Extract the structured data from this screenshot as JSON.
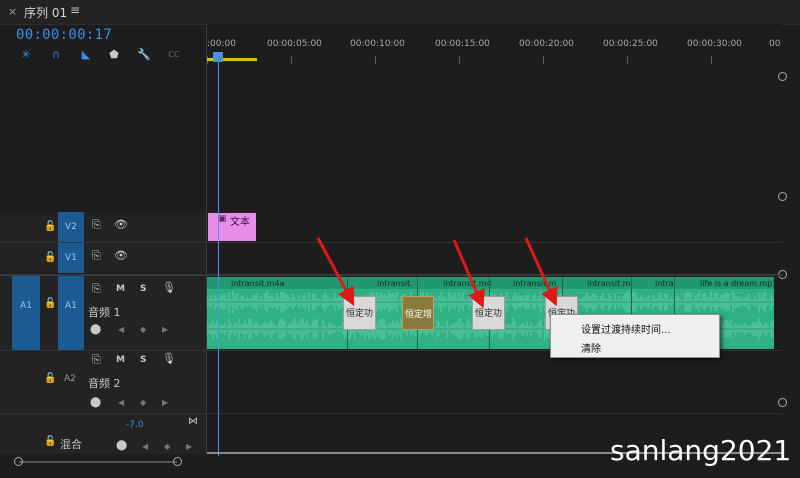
{
  "panel": {
    "close": "×",
    "title": "序列 01",
    "menu": "≡"
  },
  "timecode": "00:00:00:17",
  "ruler": {
    "ticks": [
      ":00:00",
      "00:00:05:00",
      "00:00:10:00",
      "00:00:15:00",
      "00:00:20:00",
      "00:00:25:00",
      "00:00:30:00",
      "00"
    ]
  },
  "tracks": {
    "v2": {
      "label": "V2"
    },
    "v1": {
      "label": "V1"
    },
    "a1": {
      "source": "A1",
      "label": "A1",
      "m": "M",
      "s": "S",
      "name": "音频 1"
    },
    "a2": {
      "label": "A2",
      "m": "M",
      "s": "S",
      "name": "音频 2"
    },
    "mix": {
      "name": "混合",
      "level": "-7.0"
    }
  },
  "clips": {
    "text_clip": {
      "name": "文本"
    },
    "audio": [
      {
        "name": "intransit.m4a"
      },
      {
        "name": "intransit."
      },
      {
        "name": "intransit.m4"
      },
      {
        "name": "intransit.m"
      },
      {
        "name": "intransit.m"
      },
      {
        "name": "intra"
      },
      {
        "name": "life is a dream.mp3"
      }
    ],
    "transitions": [
      {
        "label": "恒定功"
      },
      {
        "label": "恒定增"
      },
      {
        "label": "恒定功"
      },
      {
        "label": "恒定功"
      }
    ]
  },
  "context_menu": {
    "items": [
      "设置过渡持续时间...",
      "清除"
    ]
  },
  "watermark": "sanlang2021",
  "colors": {
    "accent": "#3d8ee8",
    "text_clip": "#e68de8",
    "audio_clip": "#2fb184",
    "arrow": "#e01818"
  }
}
